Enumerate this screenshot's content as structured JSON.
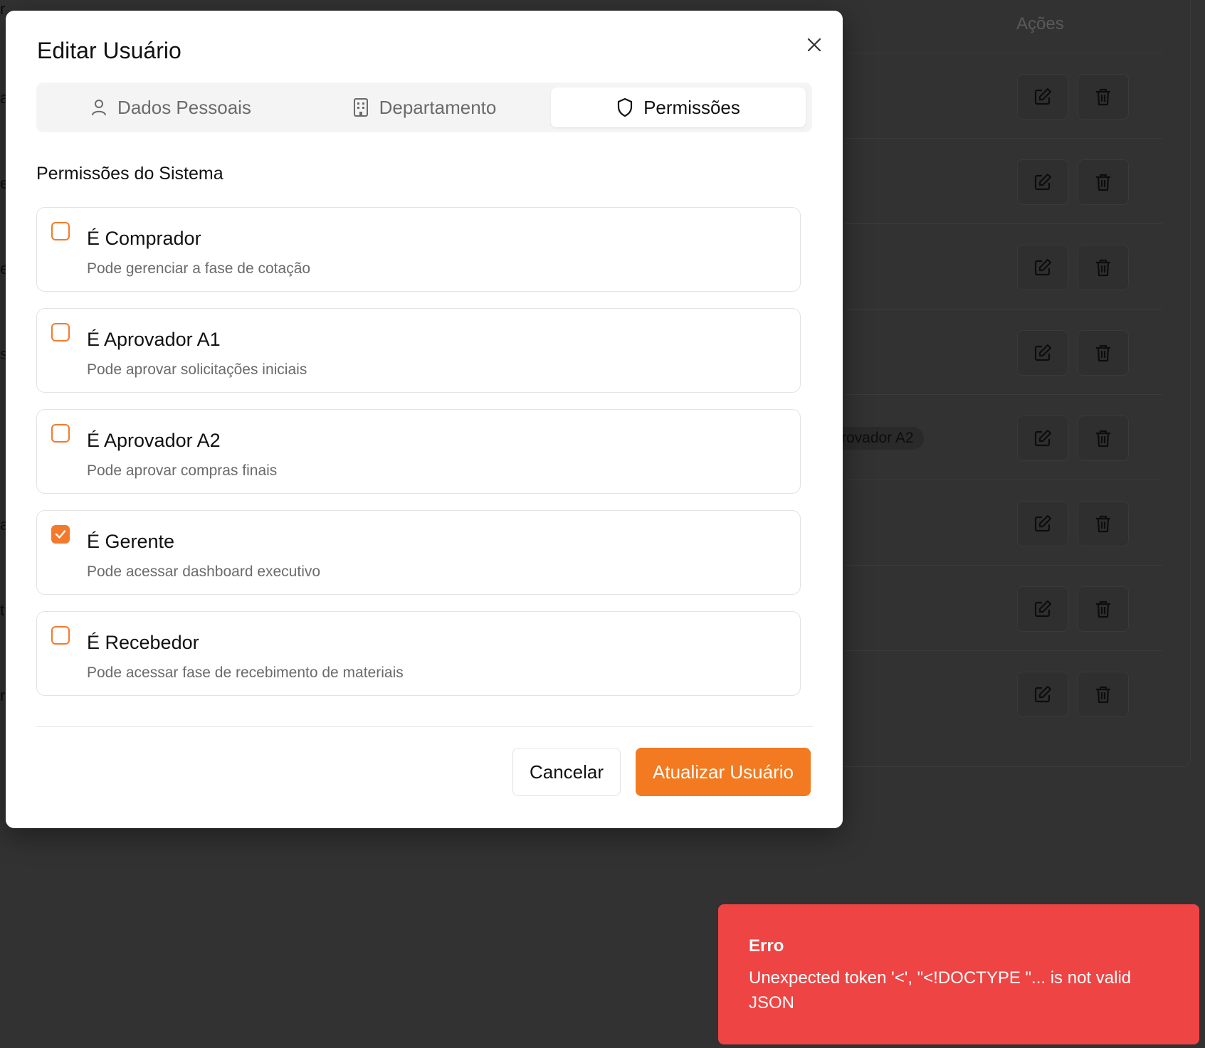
{
  "background": {
    "actions_header": "Ações",
    "badge_fragment": "rovador A2",
    "left_chars": [
      "r",
      "a",
      "e",
      "e",
      "s",
      "a",
      "t",
      "r"
    ]
  },
  "modal": {
    "title": "Editar Usuário",
    "tabs": [
      {
        "label": "Dados Pessoais",
        "icon": "user-icon",
        "active": false
      },
      {
        "label": "Departamento",
        "icon": "building-icon",
        "active": false
      },
      {
        "label": "Permissões",
        "icon": "shield-icon",
        "active": true
      }
    ],
    "section_title": "Permissões do Sistema",
    "permissions": [
      {
        "label": "É Comprador",
        "description": "Pode gerenciar a fase de cotação",
        "checked": false
      },
      {
        "label": "É Aprovador A1",
        "description": "Pode aprovar solicitações iniciais",
        "checked": false
      },
      {
        "label": "É Aprovador A2",
        "description": "Pode aprovar compras finais",
        "checked": false
      },
      {
        "label": "É Gerente",
        "description": "Pode acessar dashboard executivo",
        "checked": true
      },
      {
        "label": "É Recebedor",
        "description": "Pode acessar fase de recebimento de materiais",
        "checked": false
      }
    ],
    "cancel_label": "Cancelar",
    "submit_label": "Atualizar Usuário"
  },
  "toast": {
    "title": "Erro",
    "message": "Unexpected token '<', \"<!DOCTYPE \"... is not valid JSON"
  },
  "colors": {
    "accent": "#f37a20",
    "toast_bg": "#ef4444",
    "overlay": "#323232"
  }
}
